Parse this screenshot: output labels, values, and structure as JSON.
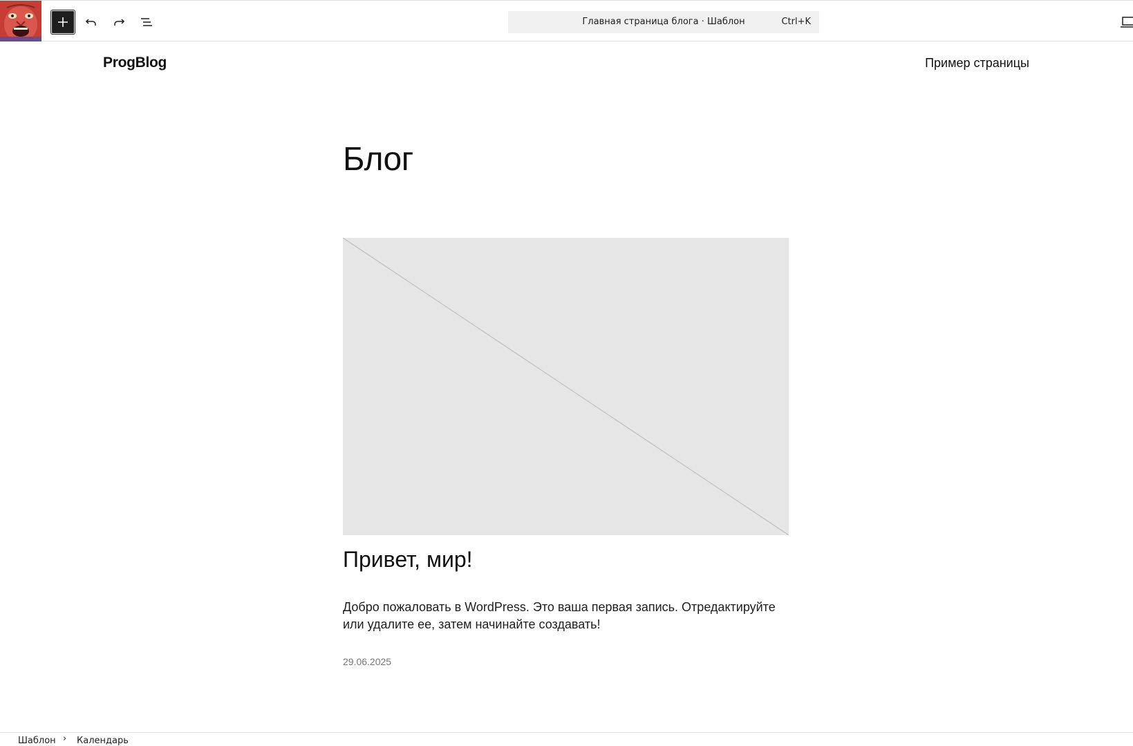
{
  "toolbar": {
    "command_title": "Главная страница блога · Шаблон",
    "command_shortcut": "Ctrl+K"
  },
  "icons": {
    "site": "site-icon",
    "add": "plus-icon",
    "undo": "undo-icon",
    "redo": "redo-icon",
    "list_view": "list-view-icon",
    "device": "desktop-icon"
  },
  "site": {
    "title": "ProgBlog",
    "nav_link": "Пример страницы"
  },
  "page": {
    "heading": "Блог"
  },
  "post": {
    "title": "Привет, мир!",
    "excerpt": "Добро пожаловать в WordPress. Это ваша первая запись. Отредактируйте или удалите ее, затем начинайте создавать!",
    "date": "29.06.2025"
  },
  "breadcrumbs": {
    "separator": "›",
    "items": [
      "Шаблон",
      "Календарь"
    ]
  },
  "colors": {
    "toolbar_dark": "#1e1e1e",
    "placeholder_bg": "#e6e6e6",
    "command_bg": "#f0f0f0",
    "date_text": "#777777"
  }
}
